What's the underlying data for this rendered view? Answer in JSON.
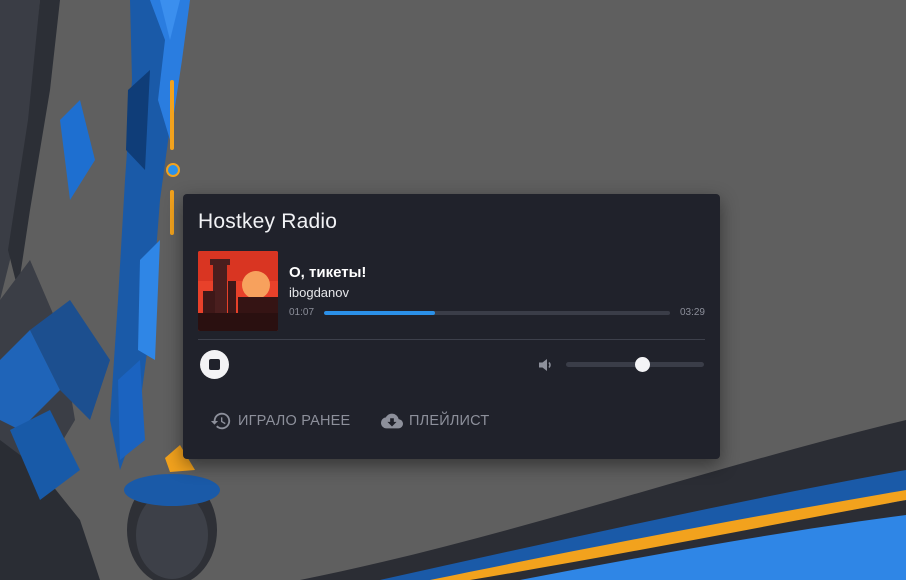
{
  "player": {
    "title": "Hostkey Radio",
    "track": {
      "title": "О, тикеты!",
      "artist": "ibogdanov",
      "elapsed": "01:07",
      "duration": "03:29",
      "progress": 0.32
    },
    "volume": 0.55,
    "buttons": {
      "history": "ИГРАЛО РАНЕЕ",
      "playlist": "ПЛЕЙЛИСТ"
    }
  },
  "icons": {
    "stop": "stop-icon",
    "volume": "volume-icon",
    "history": "history-icon",
    "playlist": "cloud-download-icon"
  },
  "colors": {
    "accent": "#2b90e8",
    "panel": "#20222b",
    "muted_text": "#8d909b"
  }
}
